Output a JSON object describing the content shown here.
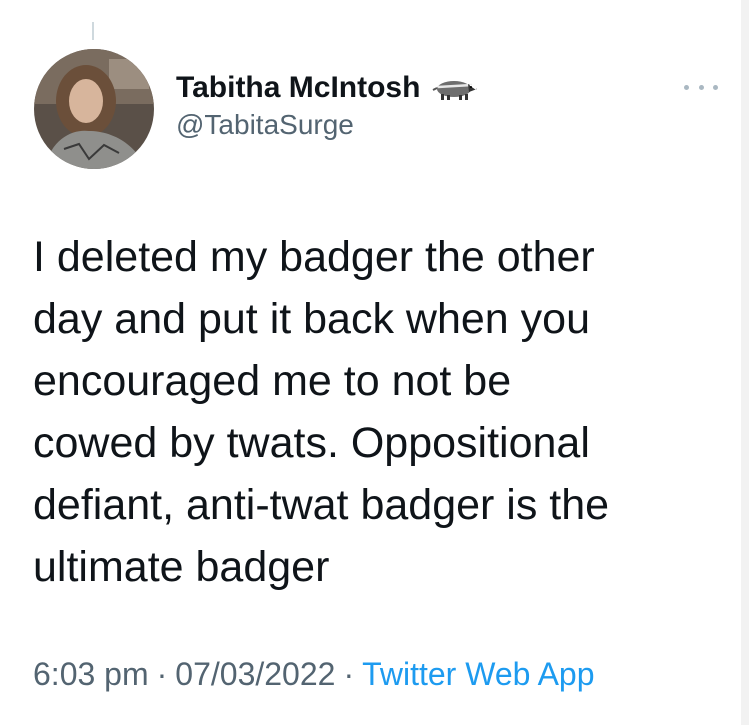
{
  "author": {
    "display_name": "Tabitha McIntosh",
    "handle": "@TabitaSurge",
    "badge_icon": "badger-emoji"
  },
  "tweet": {
    "text": "I deleted my badger the other\nday and put it back when you\nencouraged me to not be\ncowed by twats. Oppositional\ndefiant, anti-twat badger is the\nultimate badger",
    "time": "6:03 pm",
    "date": "07/03/2022",
    "separator": "·",
    "source": "Twitter Web App"
  },
  "colors": {
    "text": "#0f1419",
    "secondary": "#536471",
    "link": "#1d9bf0"
  }
}
